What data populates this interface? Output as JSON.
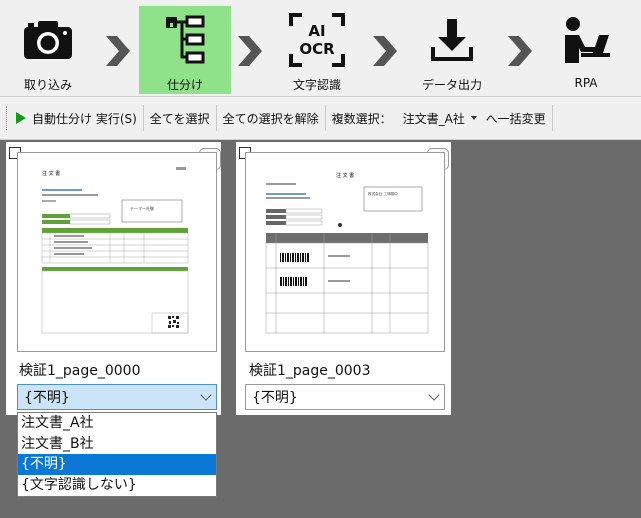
{
  "steps": [
    {
      "label": "取り込み",
      "icon": "camera-icon"
    },
    {
      "label": "仕分け",
      "icon": "tree-sort-icon",
      "active": true
    },
    {
      "label": "文字認識",
      "icon": "ai-ocr-icon",
      "icon_text_top": "AI",
      "icon_text_bottom": "OCR"
    },
    {
      "label": "データ出力",
      "icon": "download-icon"
    },
    {
      "label": "RPA",
      "icon": "person-laptop-icon"
    }
  ],
  "toolbar": {
    "auto_sort_label": "自動仕分け 実行(S)",
    "select_all_label": "全てを選択",
    "deselect_all_label": "全ての選択を解除",
    "multi_select_label": "複数選択：",
    "bulk_target_value": "注文書_A社",
    "bulk_change_label": "へ一括変更"
  },
  "cards": [
    {
      "filename": "検証1_page_0000",
      "category": "{不明}",
      "dropdown_open": true,
      "thumb": {
        "title": "注 文 書",
        "company": "テーマー社御"
      }
    },
    {
      "filename": "検証1_page_0003",
      "category": "{不明}",
      "dropdown_open": false,
      "thumb": {
        "title": "注 文 書",
        "company": "株式会社 工場御中"
      }
    }
  ],
  "dropdown_options": [
    "注文書_A社",
    "注文書_B社",
    "{不明}",
    "{文字認識しない}"
  ],
  "dropdown_selected_index": 2,
  "colors": {
    "active_step": "#8fe28a",
    "selected_option": "#0b78d7",
    "workspace": "#6b6b6b"
  }
}
